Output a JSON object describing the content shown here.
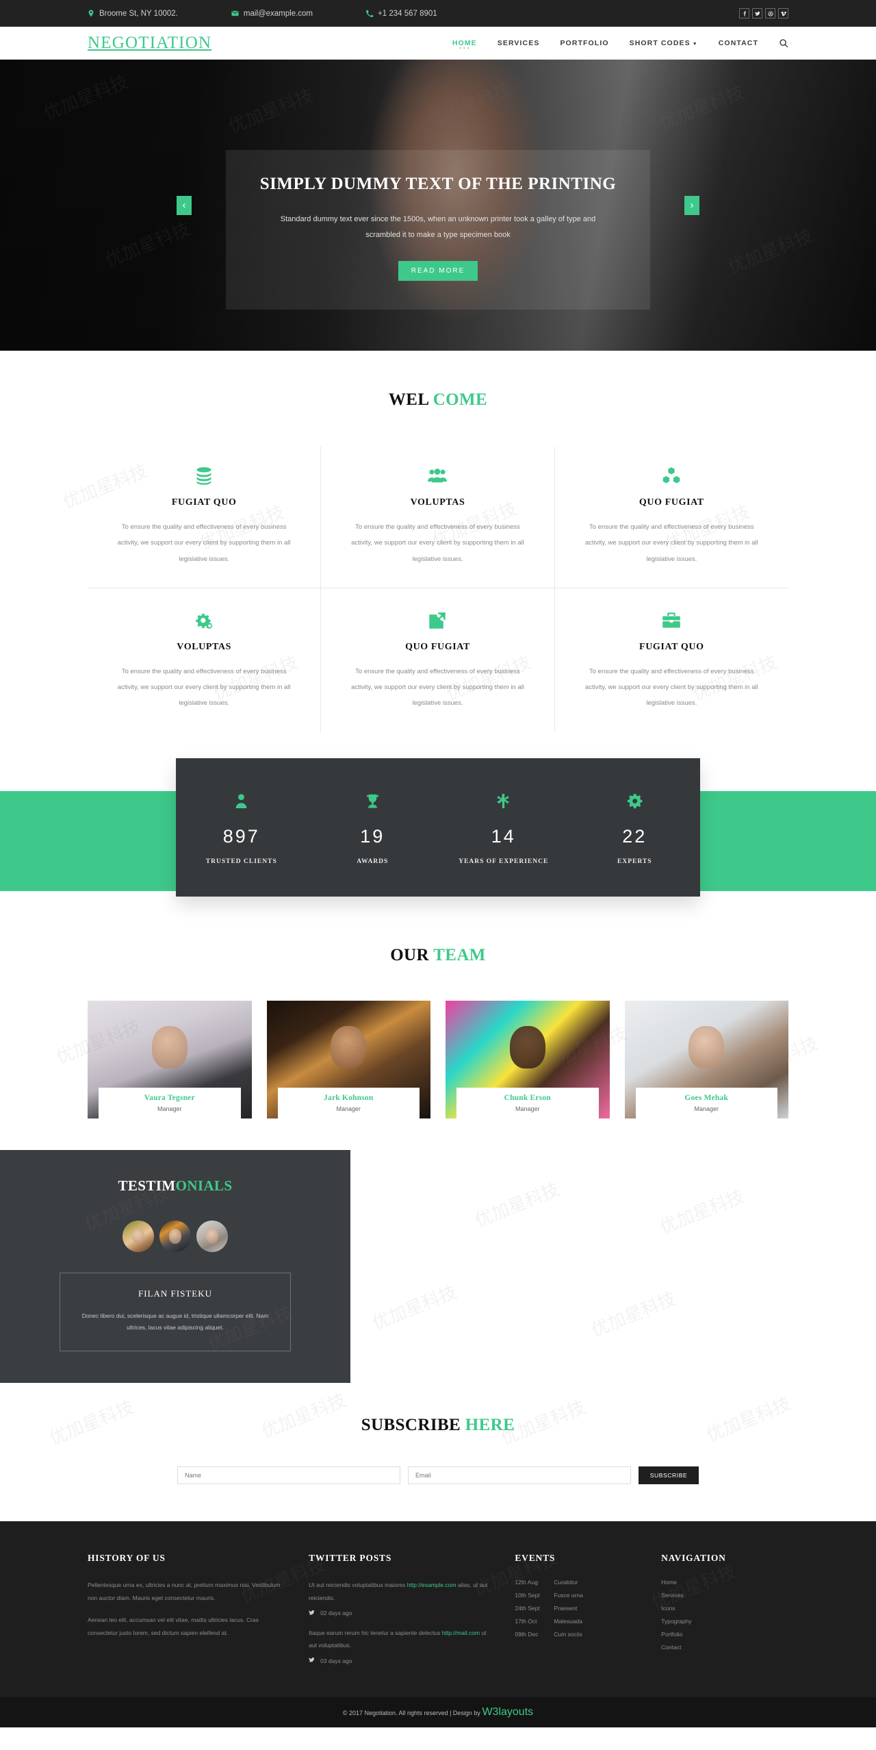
{
  "topbar": {
    "address": "Broome St, NY 10002.",
    "email": "mail@example.com",
    "phone": "+1 234 567 8901",
    "social": [
      "facebook",
      "twitter",
      "dribbble",
      "vimeo"
    ]
  },
  "header": {
    "logo": "NEGOTIATION",
    "nav": [
      {
        "label": "HOME",
        "active": true
      },
      {
        "label": "SERVICES",
        "active": false
      },
      {
        "label": "PORTFOLIO",
        "active": false
      },
      {
        "label": "SHORT CODES",
        "active": false,
        "caret": true
      },
      {
        "label": "CONTACT",
        "active": false
      }
    ],
    "search_icon": "search-icon"
  },
  "banner": {
    "title": "SIMPLY DUMMY TEXT OF THE PRINTING",
    "text": "Standard dummy text ever since the 1500s, when an unknown printer took a galley of type and scrambled it to make a type specimen book",
    "cta": "READ MORE",
    "prev": "‹",
    "next": "›"
  },
  "welcome": {
    "title_dark": "WEL",
    "title_green": "COME",
    "body": "To ensure the quality and effectiveness of every business activity, we support our every client by supporting them in all legislative issues.",
    "services": [
      {
        "title": "FUGIAT QUO",
        "icon": "database-icon"
      },
      {
        "title": "VOLUPTAS",
        "icon": "users-icon"
      },
      {
        "title": "QUO FUGIAT",
        "icon": "cubes-icon"
      },
      {
        "title": "VOLUPTAS",
        "icon": "cogs-icon"
      },
      {
        "title": "QUO FUGIAT",
        "icon": "external-link-icon"
      },
      {
        "title": "FUGIAT QUO",
        "icon": "briefcase-icon"
      }
    ]
  },
  "stats": [
    {
      "icon": "user-icon",
      "value": "897",
      "label": "TRUSTED CLIENTS"
    },
    {
      "icon": "trophy-icon",
      "value": "19",
      "label": "AWARDS"
    },
    {
      "icon": "asterisk-icon",
      "value": "14",
      "label": "YEARS OF EXPERIENCE"
    },
    {
      "icon": "gear-icon",
      "value": "22",
      "label": "EXPERTS"
    }
  ],
  "team": {
    "title_dark": "OUR",
    "title_green": "TEAM",
    "members": [
      {
        "name": "Vaura Tegsner",
        "role": "Manager"
      },
      {
        "name": "Jark Kohnson",
        "role": "Manager"
      },
      {
        "name": "Chunk Erson",
        "role": "Manager"
      },
      {
        "name": "Goes Mehak",
        "role": "Manager"
      }
    ]
  },
  "testimonials": {
    "title_white": "TESTIM",
    "title_green": "ONIALS",
    "author": "FILAN FISTEKU",
    "quote": "Donec libero dui, scelerisque ac augue id, tristique ullamcorper elit. Nam ultrices, lacus vitae adipiscing aliquet."
  },
  "subscribe": {
    "title_dark": "SUBSCRIBE",
    "title_green": "HERE",
    "name_placeholder": "Name",
    "email_placeholder": "Email",
    "button": "SUBSCRIBE"
  },
  "footer": {
    "history": {
      "title": "HISTORY OF US",
      "p1": "Pellentesque urna ex, ultricies a nunc at, pretium maximus nisi. Vestibulum non auctor diam. Mauris eget consectetur mauris.",
      "p2": "Aenean leo elit, accumsan vel elit vitae, mattis ultricies lacus. Cras consectetur justo lorem, sed dictum sapien eleifend at."
    },
    "twitter": {
      "title": "TWITTER POSTS",
      "posts": [
        {
          "text_before": "Ut aut reiciendis voluptatibus maiores ",
          "link": "http://example.com",
          "text_after": " alias, ut aut reiciendis.",
          "time": "02 days ago"
        },
        {
          "text_before": "Itaque earum rerum hic tenetur a sapiente delectus ",
          "link": "http://mail.com",
          "text_after": " ut aut voluptatibus.",
          "time": "03 days ago"
        }
      ]
    },
    "events": {
      "title": "EVENTS",
      "items": [
        {
          "date": "12th Aug",
          "name": "Curabitur"
        },
        {
          "date": "10th Sept",
          "name": "Fusce urna"
        },
        {
          "date": "24th Sept",
          "name": "Praesent"
        },
        {
          "date": "17th Oct",
          "name": "Malesuada"
        },
        {
          "date": "09th Dec",
          "name": "Cum sociis"
        }
      ]
    },
    "navigation": {
      "title": "NAVIGATION",
      "links": [
        "Home",
        "Services",
        "Icons",
        "Typography",
        "Portfolio",
        "Contact"
      ]
    }
  },
  "copyright": {
    "text": "© 2017 Negotiation. All rights reserved | Design by ",
    "link": "W3layouts"
  },
  "colors": {
    "accent": "#3ec98a",
    "dark": "#222222",
    "card_dark": "#36393c",
    "footer": "#1e1e1e"
  }
}
